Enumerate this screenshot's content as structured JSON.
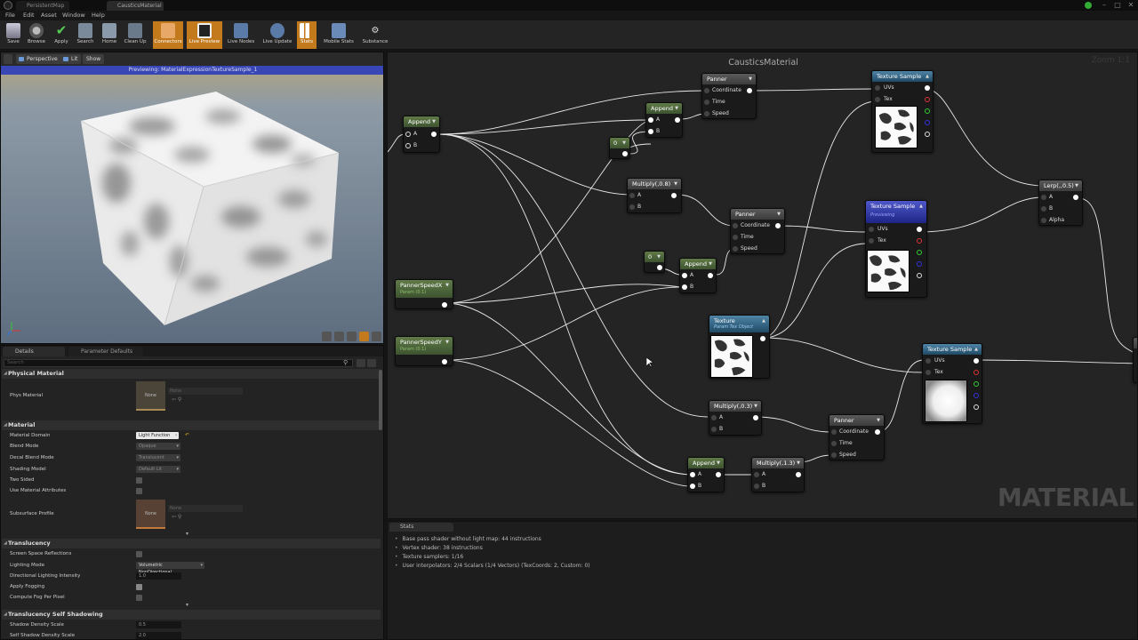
{
  "titlebar": {
    "tabs": [
      "PersistentMap",
      "CausticsMaterial"
    ]
  },
  "menu": [
    "File",
    "Edit",
    "Asset",
    "Window",
    "Help"
  ],
  "toolbar": {
    "buttons": [
      "Save",
      "Browse",
      "Apply",
      "Search",
      "Home",
      "Clean Up",
      "Connectors",
      "Live Preview",
      "Live Nodes",
      "Live Update",
      "Stats",
      "Mobile Stats",
      "Substance"
    ]
  },
  "viewport": {
    "perspective": "Perspective",
    "lit": "Lit",
    "show": "Show",
    "status": "Previewing: MaterialExpressionTextureSample_1"
  },
  "details": {
    "tabs": [
      "Details",
      "Parameter Defaults"
    ],
    "search_placeholder": "Search",
    "categories": {
      "physical": "Physical Material",
      "material": "Material",
      "translucency": "Translucency",
      "self_shadow": "Translucency Self Shadowing"
    },
    "phys_material_label": "Phys Material",
    "phys_material_thumb": "None",
    "phys_material_value": "None",
    "props": {
      "material_domain": {
        "label": "Material Domain",
        "value": "Light Function"
      },
      "blend_mode": {
        "label": "Blend Mode",
        "value": "Opaque"
      },
      "decal_blend_mode": {
        "label": "Decal Blend Mode",
        "value": "Translucent"
      },
      "shading_model": {
        "label": "Shading Model",
        "value": "Default Lit"
      },
      "two_sided": {
        "label": "Two Sided"
      },
      "use_material_attributes": {
        "label": "Use Material Attributes"
      },
      "subsurface_profile": {
        "label": "Subsurface Profile",
        "thumb": "None",
        "value": "None"
      },
      "screen_space_reflections": {
        "label": "Screen Space Reflections"
      },
      "lighting_mode": {
        "label": "Lighting Mode",
        "value": "Volumetric NonDirectional"
      },
      "directional_lighting_intensity": {
        "label": "Directional Lighting Intensity",
        "value": "1.0"
      },
      "apply_fogging": {
        "label": "Apply Fogging"
      },
      "compute_fog_per_pixel": {
        "label": "Compute Fog Per Pixel"
      },
      "shadow_density_scale": {
        "label": "Shadow Density Scale",
        "value": "0.5"
      },
      "self_shadow_density_scale": {
        "label": "Self Shadow Density Scale",
        "value": "2.0"
      }
    }
  },
  "graph": {
    "title": "CausticsMaterial",
    "zoom": "Zoom 1:1",
    "watermark": "MATERIAL",
    "nodes": {
      "append1": {
        "title": "Append",
        "pins": [
          "A",
          "B"
        ]
      },
      "panner1": {
        "title": "Panner",
        "pins": [
          "Coordinate",
          "Time",
          "Speed"
        ]
      },
      "append2": {
        "title": "Append",
        "pins": [
          "A",
          "B"
        ]
      },
      "const0a": {
        "title": "0"
      },
      "texsample1": {
        "title": "Texture Sample",
        "pins": [
          "UVs",
          "Tex"
        ]
      },
      "multiply08": {
        "title": "Multiply(,0.8)",
        "pins": [
          "A",
          "B"
        ]
      },
      "panner2": {
        "title": "Panner",
        "pins": [
          "Coordinate",
          "Time",
          "Speed"
        ]
      },
      "texsample2": {
        "title": "Texture Sample",
        "sub": "Previewing",
        "pins": [
          "UVs",
          "Tex"
        ]
      },
      "lerp": {
        "title": "Lerp(,,0.5)",
        "pins": [
          "A",
          "B",
          "Alpha"
        ]
      },
      "const0b": {
        "title": "0"
      },
      "append3": {
        "title": "Append",
        "pins": [
          "A",
          "B"
        ]
      },
      "pannerX": {
        "title": "PannerSpeedX",
        "sub": "Param (0.1)"
      },
      "pannerY": {
        "title": "PannerSpeedY",
        "sub": "Param (0.1)"
      },
      "texture": {
        "title": "Texture",
        "sub": "Param Tex Object"
      },
      "texsample3": {
        "title": "Texture Sample",
        "pins": [
          "UVs",
          "Tex"
        ]
      },
      "multiply03": {
        "title": "Multiply(,0.3)",
        "pins": [
          "A",
          "B"
        ]
      },
      "panner3": {
        "title": "Panner",
        "pins": [
          "Coordinate",
          "Time",
          "Speed"
        ]
      },
      "append4": {
        "title": "Append",
        "pins": [
          "A",
          "B"
        ]
      },
      "multiply13": {
        "title": "Multiply(,1.3)",
        "pins": [
          "A",
          "B"
        ]
      }
    }
  },
  "stats": {
    "tab": "Stats",
    "lines": [
      "Base pass shader without light map: 44 instructions",
      "Vertex shader: 38 instructions",
      "Texture samplers: 1/16",
      "User interpolators: 2/4 Scalars (1/4 Vectors) (TexCoords: 2, Custom: 0)"
    ]
  },
  "colors": {
    "accent_orange": "#c27a1c",
    "node_header_green": "#4d6a3a",
    "node_header_gray": "#4a4a4a",
    "node_header_teal": "#2f6787",
    "node_header_blue": "#2d35a8",
    "preview_banner": "#3947b6"
  },
  "icons": [
    "ue-logo-icon",
    "save-icon",
    "browse-icon",
    "apply-icon",
    "search-icon",
    "home-icon",
    "cleanup-icon",
    "connectors-icon",
    "live-preview-icon",
    "live-nodes-icon",
    "live-update-icon",
    "stats-icon",
    "mobile-stats-icon",
    "substance-icon",
    "eye-icon",
    "gear-icon"
  ]
}
